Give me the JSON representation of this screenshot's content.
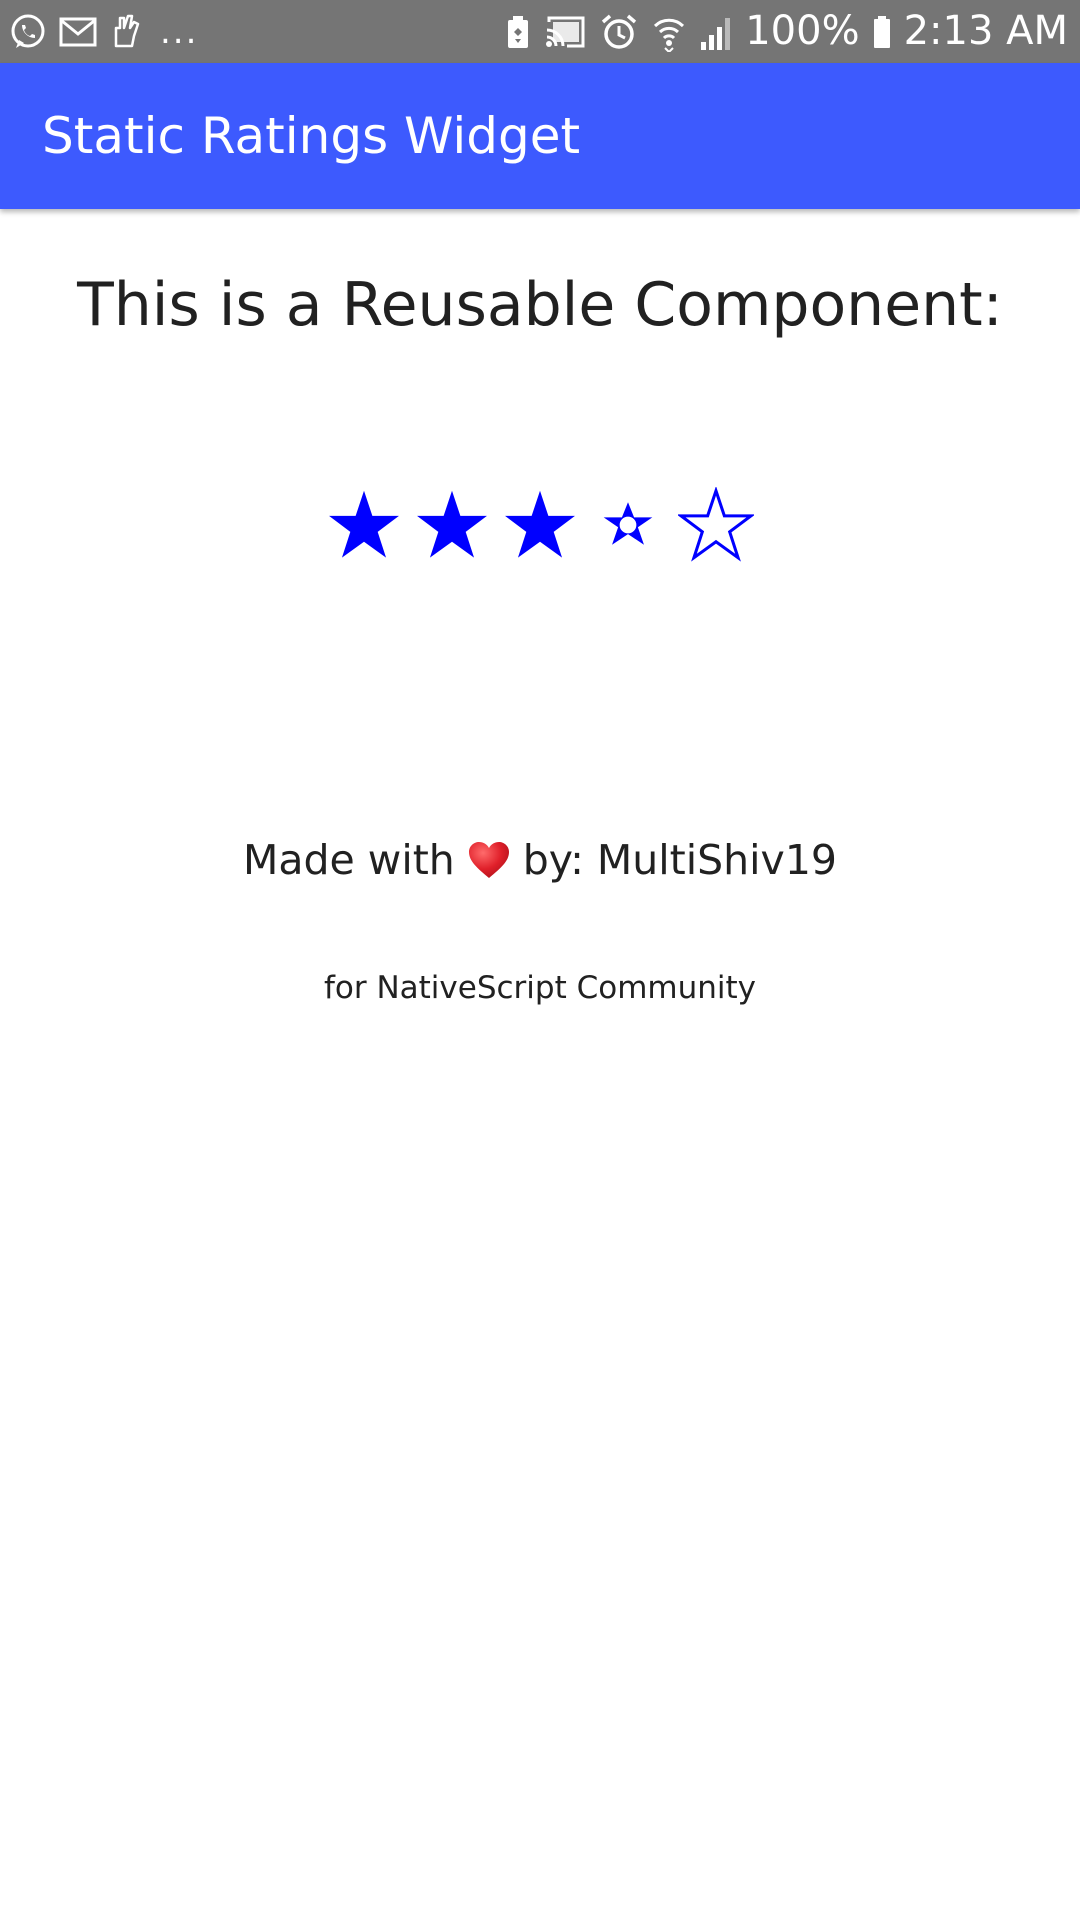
{
  "status_bar": {
    "notification_icons": [
      "whatsapp-icon",
      "gmail-icon",
      "hand-icon"
    ],
    "more_indicator": "...",
    "system_icons": [
      "battery-saver-icon",
      "cast-icon",
      "alarm-icon",
      "wifi-icon",
      "signal-icon",
      "battery-icon"
    ],
    "battery_percent": "100%",
    "time": "2:13 AM"
  },
  "app_bar": {
    "title": "Static Ratings Widget",
    "color": "#3D5AFE"
  },
  "main": {
    "heading": "This is a Reusable Component:",
    "rating": {
      "value": 3.5,
      "max": 5,
      "star_color": "#0000FF",
      "star_states": [
        "full",
        "full",
        "full",
        "half",
        "empty"
      ]
    },
    "made_with_prefix": "Made with",
    "heart_icon": "heart-icon",
    "made_with_suffix": "by: MultiShiv19",
    "community": "for NativeScript Community"
  }
}
